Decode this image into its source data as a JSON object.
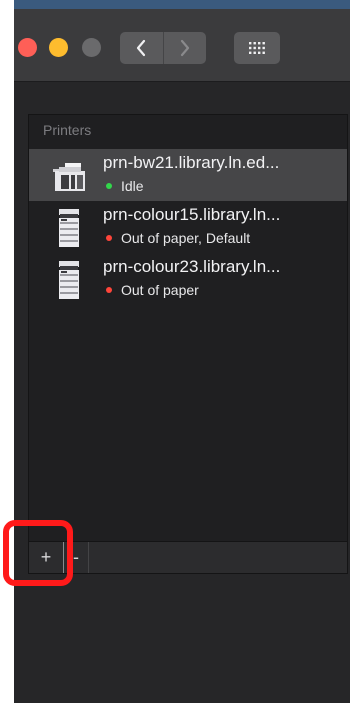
{
  "window": {
    "controls": [
      {
        "name": "close",
        "color": "#fe5f57"
      },
      {
        "name": "minimize",
        "color": "#febc2e"
      },
      {
        "name": "zoom",
        "color": "#6a6a6c"
      }
    ],
    "nav": {
      "back_icon": "chevron-left-icon",
      "forward_icon": "chevron-right-icon"
    },
    "grid_icon": "grid-icon"
  },
  "printers": {
    "header": "Printers",
    "items": [
      {
        "name": "prn-bw21.library.ln.ed...",
        "status": "Idle",
        "status_color": "green",
        "selected": true,
        "icon": "printer-icon"
      },
      {
        "name": "prn-colour15.library.ln...",
        "status": "Out of paper, Default",
        "status_color": "red",
        "selected": false,
        "icon": "printer-icon"
      },
      {
        "name": "prn-colour23.library.ln...",
        "status": "Out of paper",
        "status_color": "red",
        "selected": false,
        "icon": "printer-icon"
      }
    ]
  },
  "toolbar": {
    "add_label": "+",
    "remove_label": "-"
  },
  "colors": {
    "highlight": "#ff1a1a",
    "status_idle": "#32d74b",
    "status_error": "#ff453a"
  }
}
